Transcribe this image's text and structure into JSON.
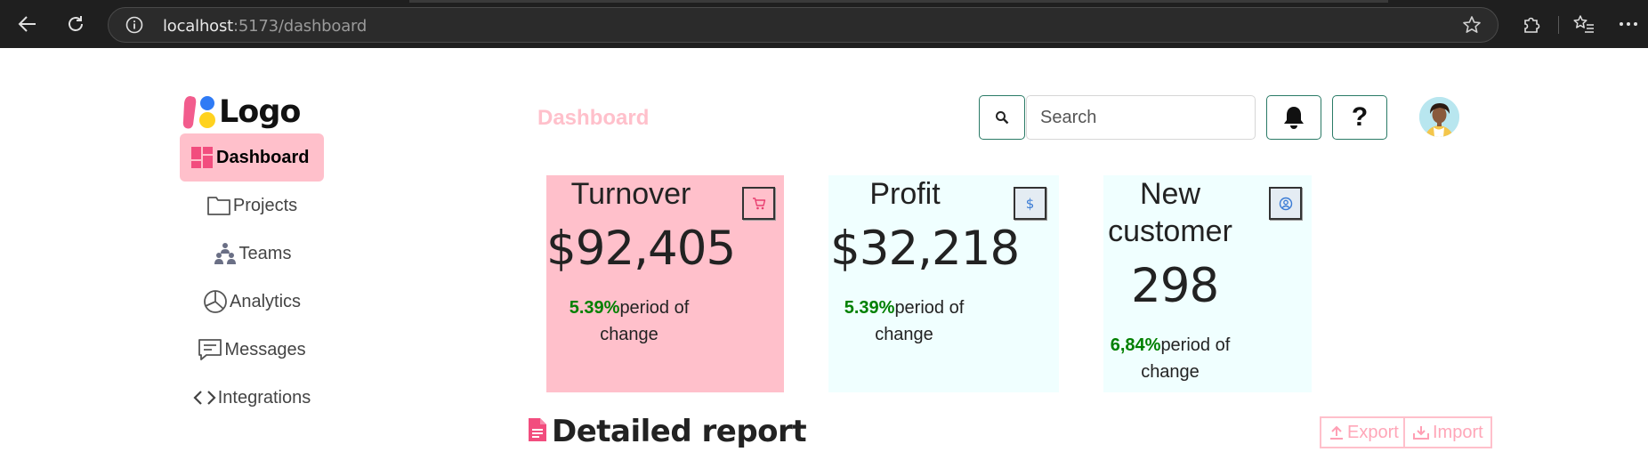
{
  "browser": {
    "url_host": "localhost",
    "url_path": ":5173/dashboard"
  },
  "sidebar": {
    "logo_text": "Logo",
    "items": [
      {
        "label": "Dashboard",
        "icon": "dashboard-icon",
        "active": true
      },
      {
        "label": "Projects",
        "icon": "folder-icon"
      },
      {
        "label": "Teams",
        "icon": "teams-icon"
      },
      {
        "label": "Analytics",
        "icon": "pie-chart-icon"
      },
      {
        "label": "Messages",
        "icon": "message-icon"
      },
      {
        "label": "Integrations",
        "icon": "code-icon"
      }
    ]
  },
  "header": {
    "title": "Dashboard",
    "search_placeholder": "Search",
    "help_label": "?"
  },
  "cards": {
    "turnover": {
      "title": "Turnover",
      "value": "$92,405",
      "change_pct": "5.39%",
      "change_text": "period of change",
      "icon": "cart-icon"
    },
    "profit": {
      "title": "Profit",
      "value": "$32,218",
      "change_pct": "5.39%",
      "change_text": "period of change",
      "icon": "dollar-icon"
    },
    "customers": {
      "title": "New customer",
      "value": "298",
      "change_pct": "6,84%",
      "change_text": "period of change",
      "icon": "user-circle-icon"
    }
  },
  "report": {
    "title": "Detailed report",
    "export_label": "Export",
    "import_label": "Import"
  },
  "colors": {
    "accent_pink": "#ffc0cb",
    "card_cyan": "#f0ffff",
    "positive_green": "#008000",
    "button_border": "#2a7a66"
  }
}
